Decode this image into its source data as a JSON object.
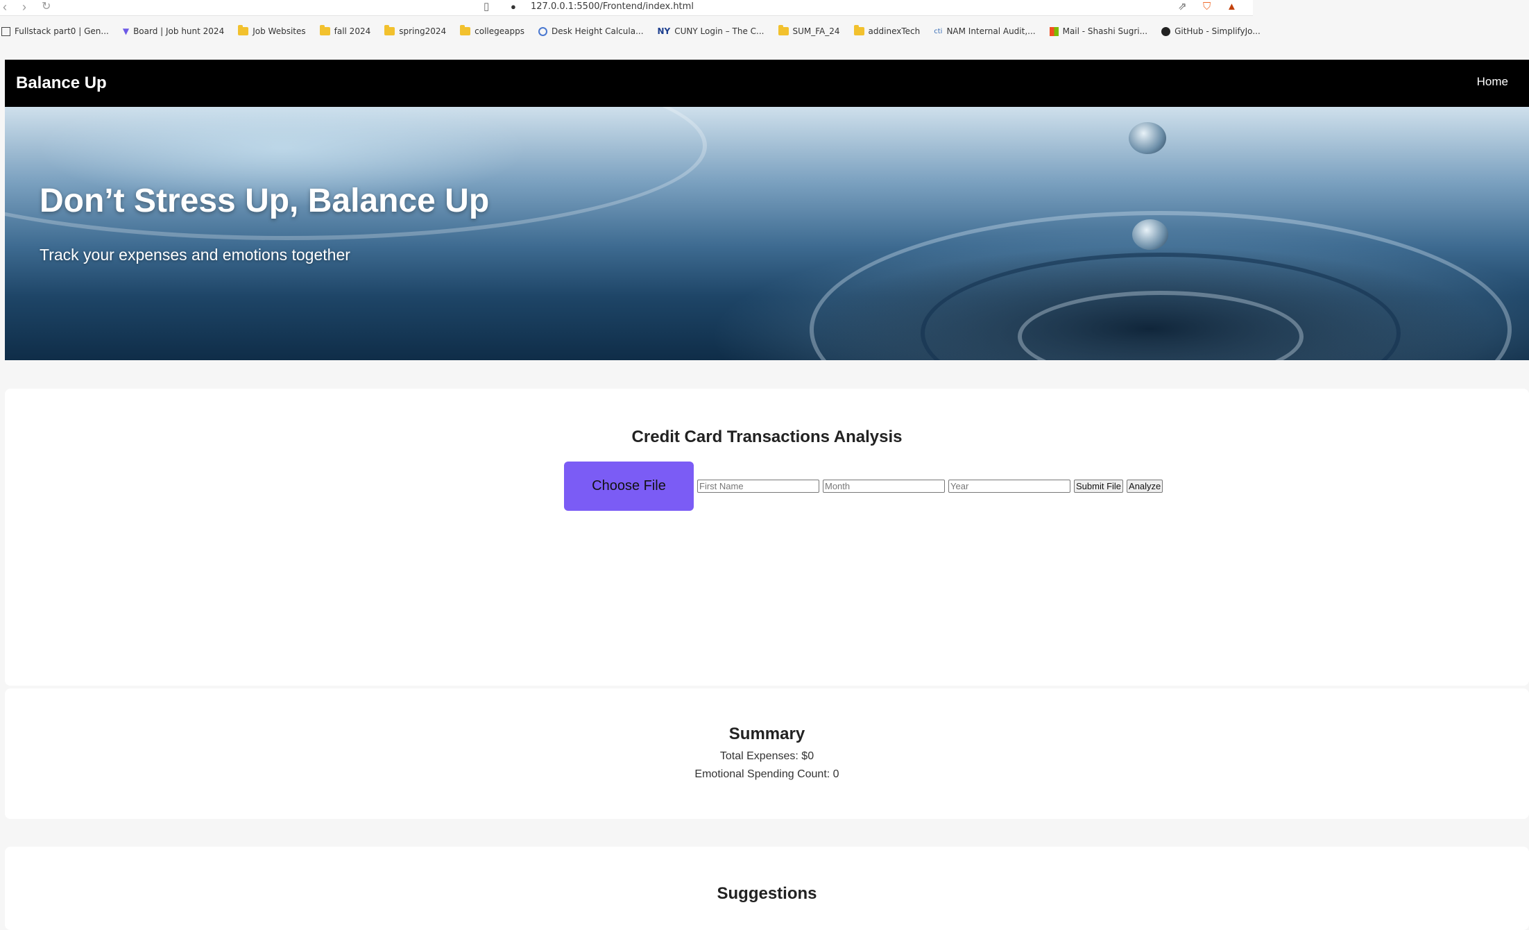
{
  "browser": {
    "url": "127.0.0.1:5500/Frontend/index.html",
    "bookmarks": [
      {
        "label": "Fullstack part0 | Gen...",
        "icon": "page-icon"
      },
      {
        "label": "Board | Job hunt 2024",
        "icon": "board-icon"
      },
      {
        "label": "Job Websites",
        "icon": "folder-icon"
      },
      {
        "label": "fall 2024",
        "icon": "folder-icon"
      },
      {
        "label": "spring2024",
        "icon": "folder-icon"
      },
      {
        "label": "collegeapps",
        "icon": "folder-icon"
      },
      {
        "label": "Desk Height Calcula...",
        "icon": "desk-icon"
      },
      {
        "label": "CUNY Login – The C...",
        "icon": "cuny-icon"
      },
      {
        "label": "SUM_FA_24",
        "icon": "folder-icon"
      },
      {
        "label": "addinexTech",
        "icon": "folder-icon"
      },
      {
        "label": "NAM Internal Audit,...",
        "icon": "audit-icon"
      },
      {
        "label": "Mail - Shashi Sugri...",
        "icon": "mail-icon"
      },
      {
        "label": "GitHub - SimplifyJo...",
        "icon": "github-icon"
      }
    ]
  },
  "navbar": {
    "brand": "Balance Up",
    "home": "Home"
  },
  "hero": {
    "title": "Don’t Stress Up, Balance Up",
    "subtitle": "Track your expenses and emotions together"
  },
  "analysis": {
    "title": "Credit Card Transactions Analysis",
    "choose_file": "Choose File",
    "first_name_placeholder": "First Name",
    "month_placeholder": "Month",
    "year_placeholder": "Year",
    "submit": "Submit File",
    "analyze": "Analyze"
  },
  "summary": {
    "title": "Summary",
    "total_expenses": "Total Expenses: $0",
    "emotional_count": "Emotional Spending Count: 0"
  },
  "suggestions": {
    "title": "Suggestions"
  }
}
